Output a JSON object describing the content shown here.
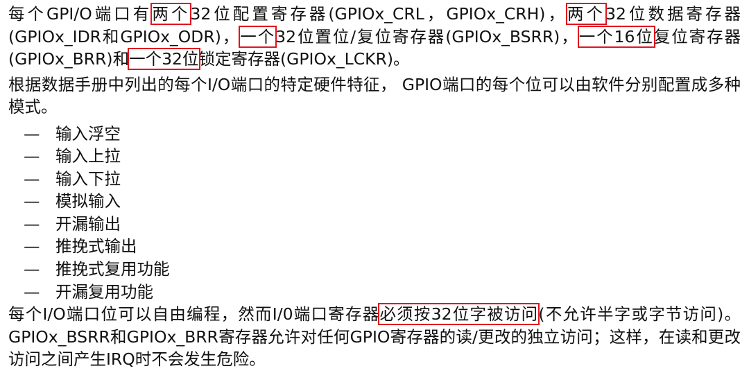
{
  "paragraph_1": {
    "t1": "每个GPI/O端口有",
    "h1": "两个",
    "t2": "32位配置寄存器(GPIOx_CRL，GPIOx_CRH)，",
    "h2": "两个",
    "t3": "32位数据寄存器(GPIOx_IDR和GPIOx_ODR)，",
    "h3": "一个",
    "t4": "32位置位/复位寄存器(GPIOx_BSRR)，",
    "h4": "一个16位",
    "t5": "复位寄存器(GPIOx_BRR)和",
    "h5": "一个32位",
    "t6": "锁定寄存器(GPIOx_LCKR)。"
  },
  "paragraph_2": "根据数据手册中列出的每个I/O端口的特定硬件特征， GPIO端口的每个位可以由软件分别配置成多种模式。",
  "bullet_marker": "—",
  "modes": [
    "输入浮空",
    "输入上拉",
    "输入下拉",
    "模拟输入",
    "开漏输出",
    "推挽式输出",
    "推挽式复用功能",
    "开漏复用功能"
  ],
  "paragraph_3": {
    "t1": "每个I/O端口位可以自由编程，然而I/0端口寄存器",
    "h1": "必须按32位字被访问",
    "t2": "(不允许半字或字节访问)。GPIOx_BSRR和GPIOx_BRR寄存器允许对任何GPIO寄存器的读/更改的独立访问；这样，在读和更改访问之间产生IRQ时不会发生危险。"
  },
  "colors": {
    "highlight_box": "#e0141e",
    "text": "#111111",
    "background": "#ffffff"
  }
}
